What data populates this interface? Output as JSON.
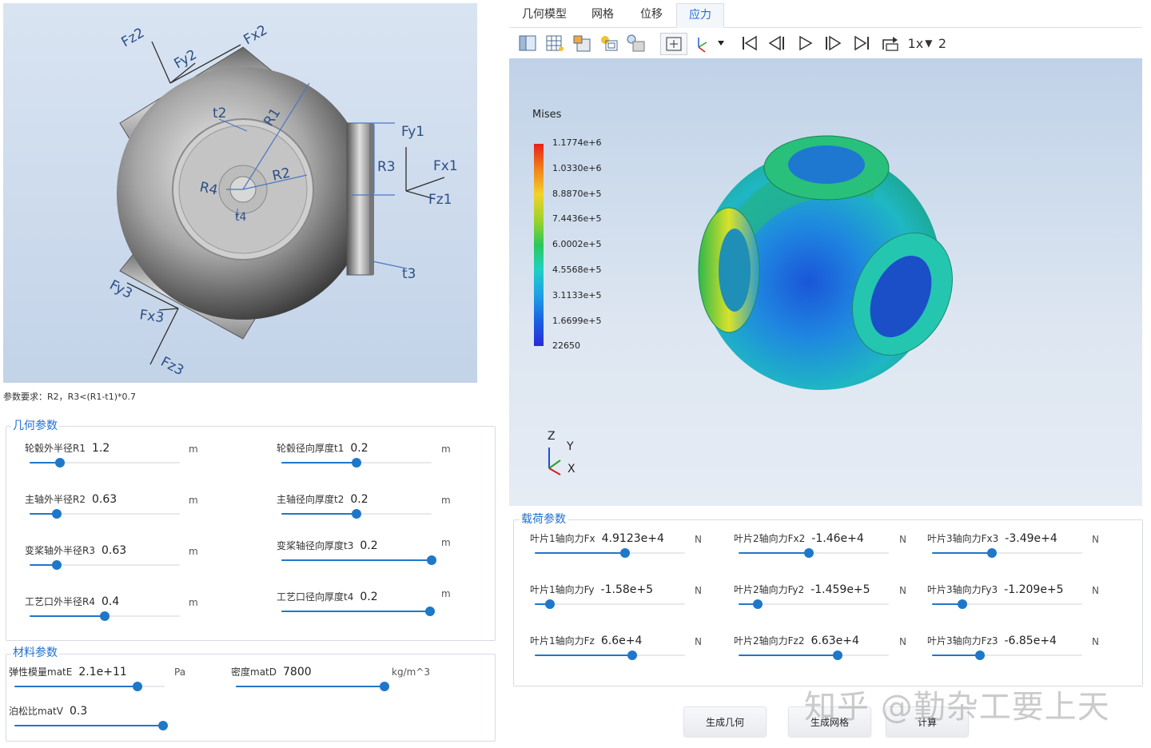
{
  "diagram": {
    "labels": {
      "fz2": "Fz2",
      "fy2": "Fy2",
      "fx2": "Fx2",
      "fy1": "Fy1",
      "fx1": "Fx1",
      "fz1": "Fz1",
      "fy3": "Fy3",
      "fx3": "Fx3",
      "fz3": "Fz3",
      "t2": "t2",
      "r1": "R1",
      "r2": "R2",
      "r3": "R3",
      "r4": "R4",
      "t4": "t4",
      "t3": "t3"
    }
  },
  "requirement": "参数要求：R2，R3<(R1-t1)*0.7",
  "geometry": {
    "title": "几何参数",
    "params": [
      {
        "label": "轮毂外半径R1",
        "value": "1.2",
        "unit": "m",
        "level": 0.2
      },
      {
        "label": "主轴外半径R2",
        "value": "0.63",
        "unit": "m",
        "level": 0.18
      },
      {
        "label": "变桨轴外半径R3",
        "value": "0.63",
        "unit": "m",
        "level": 0.18
      },
      {
        "label": "工艺口外半径R4",
        "value": "0.4",
        "unit": "m",
        "level": 0.5
      },
      {
        "label": "轮毂径向厚度t1",
        "value": "0.2",
        "unit": "m",
        "level": 0.5
      },
      {
        "label": "主轴径向厚度t2",
        "value": "0.2",
        "unit": "m",
        "level": 0.5
      },
      {
        "label": "变桨轴径向厚度t3",
        "value": "0.2",
        "unit": "m",
        "level": 1.0
      },
      {
        "label": "工艺口径向厚度t4",
        "value": "0.2",
        "unit": "m",
        "level": 0.99
      }
    ]
  },
  "material": {
    "title": "材料参数",
    "params": [
      {
        "label": "弹性模量matE",
        "value": "2.1e+11",
        "unit": "Pa",
        "level": 0.82
      },
      {
        "label": "密度matD",
        "value": "7800",
        "unit": "kg/m^3",
        "level": 1.0
      },
      {
        "label": "泊松比matV",
        "value": "0.3",
        "unit": "",
        "level": 1.0
      }
    ]
  },
  "tabs": [
    "几何模型",
    "网格",
    "位移",
    "应力"
  ],
  "active_tab": "应力",
  "toolbar": {
    "speed": "1x",
    "frame": "2"
  },
  "legend": {
    "title": "Mises",
    "ticks": [
      "1.1774e+6",
      "1.0330e+6",
      "8.8870e+5",
      "7.4436e+5",
      "6.0002e+5",
      "4.5568e+5",
      "3.1133e+5",
      "1.6699e+5",
      "22650"
    ]
  },
  "axes": {
    "z": "Z",
    "y": "Y",
    "x": "X"
  },
  "loads": {
    "title": "载荷参数",
    "params": [
      {
        "label": "叶片1轴向力Fx",
        "value": "4.9123e+4",
        "unit": "N",
        "level": 0.6
      },
      {
        "label": "叶片1轴向力Fy",
        "value": "-1.58e+5",
        "unit": "N",
        "level": 0.1
      },
      {
        "label": "叶片1轴向力Fz",
        "value": "6.6e+4",
        "unit": "N",
        "level": 0.65
      },
      {
        "label": "叶片2轴向力Fx2",
        "value": "-1.46e+4",
        "unit": "N",
        "level": 0.47
      },
      {
        "label": "叶片2轴向力Fy2",
        "value": "-1.459e+5",
        "unit": "N",
        "level": 0.13
      },
      {
        "label": "叶片2轴向力Fz2",
        "value": "6.63e+4",
        "unit": "N",
        "level": 0.66
      },
      {
        "label": "叶片3轴向力Fx3",
        "value": "-3.49e+4",
        "unit": "N",
        "level": 0.4
      },
      {
        "label": "叶片3轴向力Fy3",
        "value": "-1.209e+5",
        "unit": "N",
        "level": 0.2
      },
      {
        "label": "叶片3轴向力Fz3",
        "value": "-6.85e+4",
        "unit": "N",
        "level": 0.32
      }
    ]
  },
  "buttons": {
    "gen_geometry": "生成几何",
    "gen_mesh": "生成网格",
    "compute": "计算"
  },
  "watermark": "知乎 @勤杂工要上天"
}
